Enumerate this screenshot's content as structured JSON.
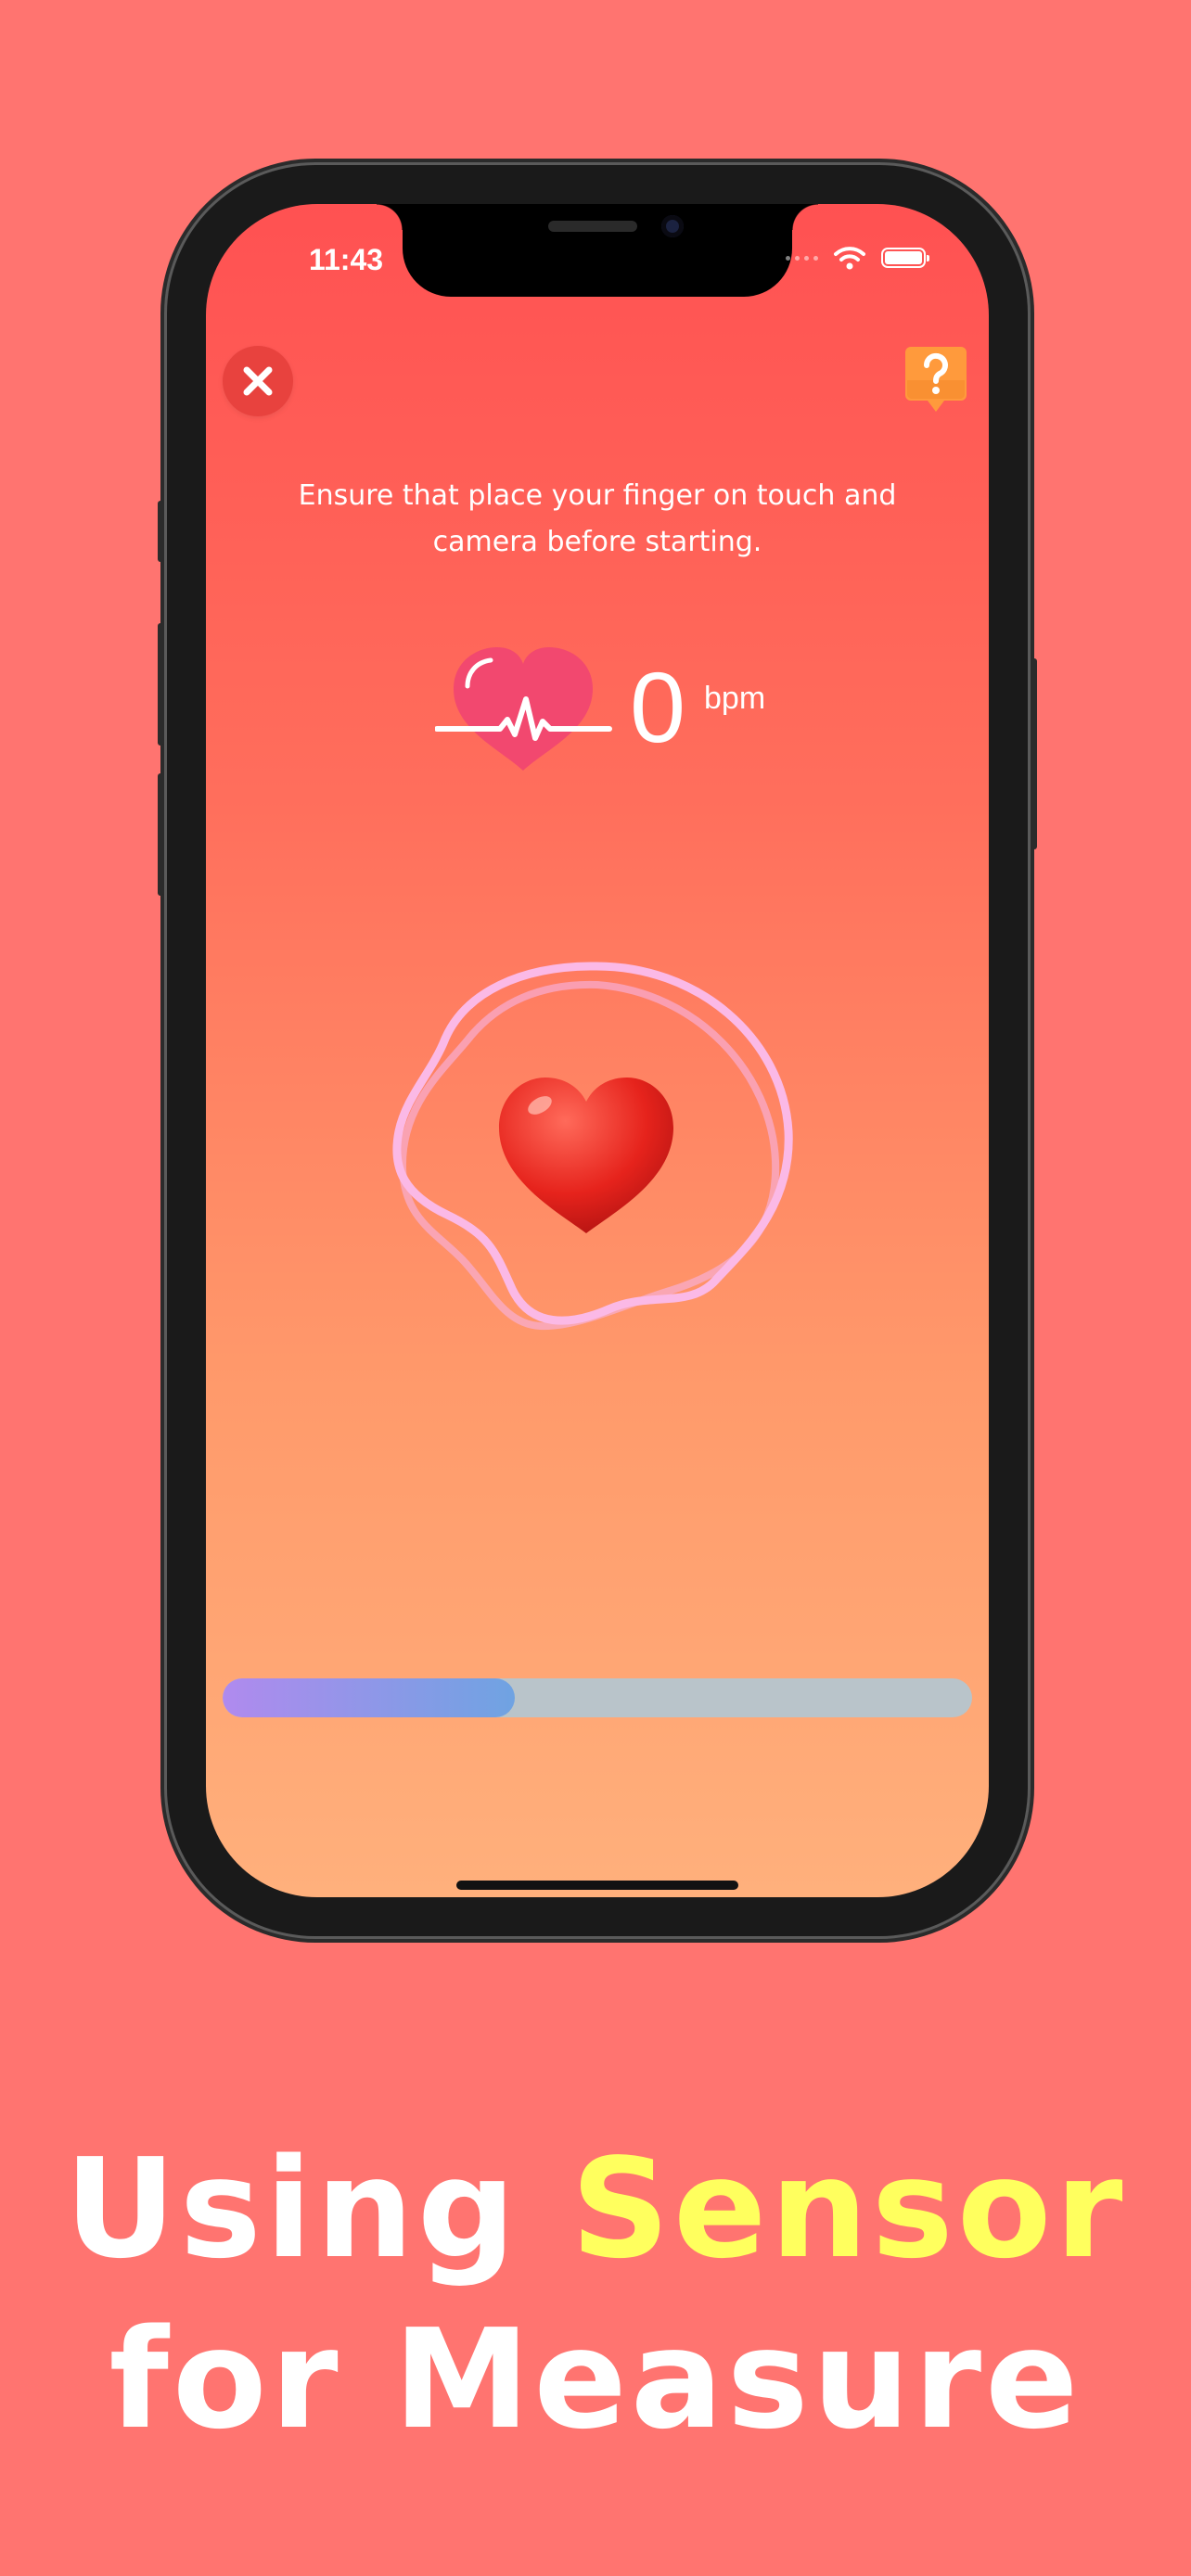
{
  "status_bar": {
    "time": "11:43"
  },
  "instruction": "Ensure that place your finger on touch and camera before starting.",
  "reading": {
    "value": "0",
    "unit": "bpm"
  },
  "progress": {
    "fraction": 0.39
  },
  "caption": {
    "line1_prefix": "Using",
    "line1_highlight": "Sensor",
    "line2": "for Measure"
  },
  "colors": {
    "background": "#FF7470",
    "highlight": "#FFFF5E",
    "close_button": "#E8423E",
    "help_button": "#FF9A3C"
  },
  "icons": {
    "close": "close-icon",
    "help": "question-bubble-icon",
    "heart_rate": "heartbeat-icon",
    "center": "3d-heart-icon"
  }
}
